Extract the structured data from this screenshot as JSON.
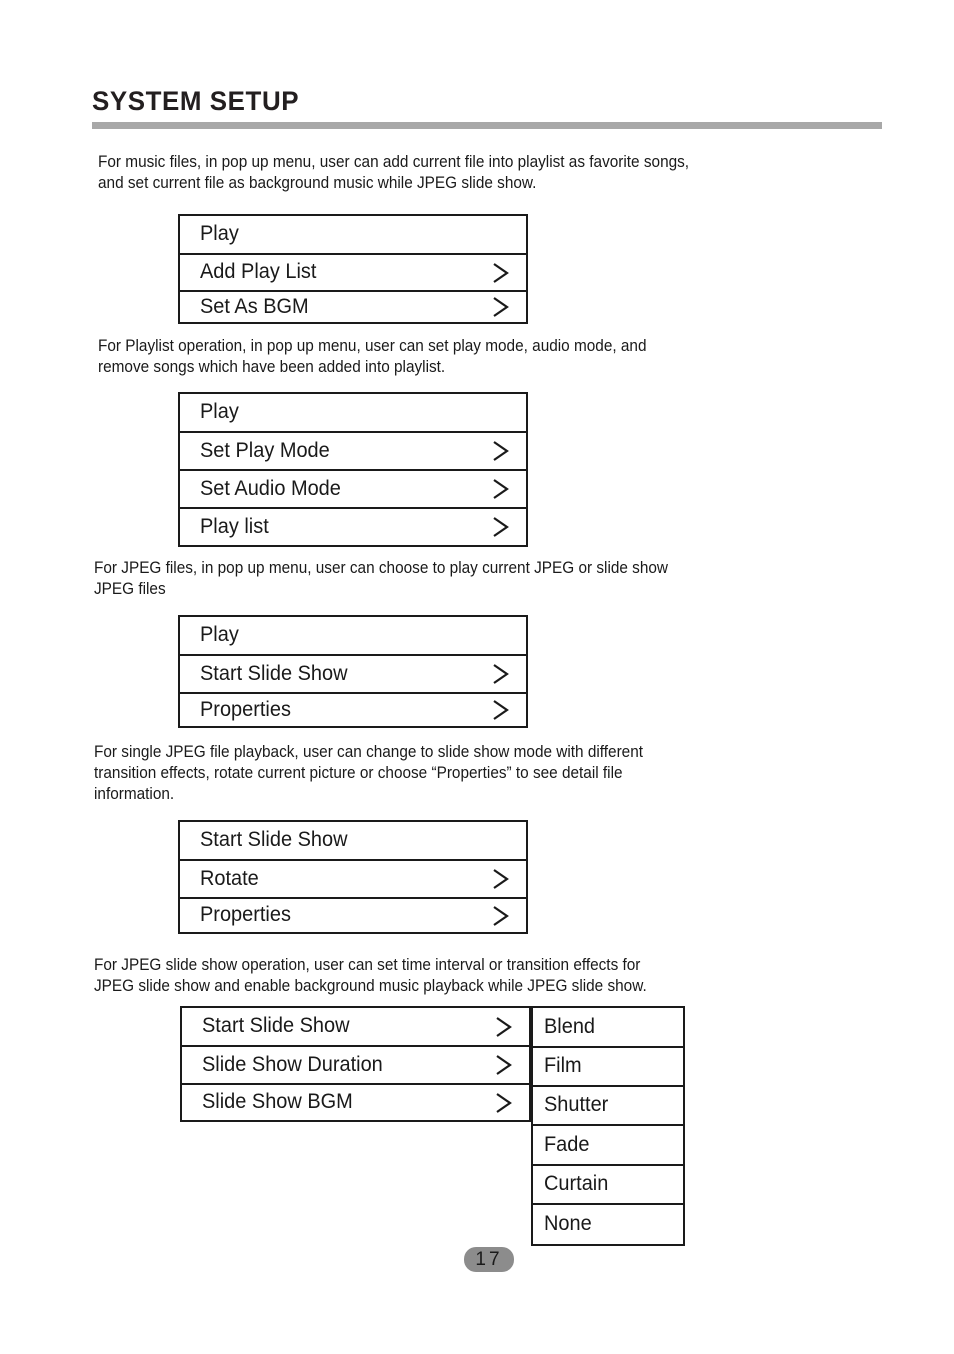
{
  "header": {
    "title": "SYSTEM SETUP"
  },
  "paragraphs": [
    {
      "id": "music-files",
      "text": "For music files, in pop up menu, user can add current file into playlist as favorite songs,\nand set current file as background music while JPEG slide show."
    },
    {
      "id": "playlist-operation",
      "text": "For Playlist operation, in pop up menu, user can set play mode, audio mode, and\nremove songs which have been added into playlist."
    },
    {
      "id": "jpeg-files",
      "text": "For JPEG files, in pop up menu, user can choose to play current JPEG or slide show\nJPEG files"
    },
    {
      "id": "single-jpeg-playback",
      "text": "For single JPEG file playback, user can change to slide show mode with different\ntransition effects, rotate current picture or choose “Properties” to see detail file\n information."
    },
    {
      "id": "jpeg-slide-show-operation",
      "text": "For JPEG slide show operation, user can set time interval or transition effects for\nJPEG slide show and enable background music playback while JPEG slide show."
    }
  ],
  "menus": [
    {
      "id": "music-popup-menu",
      "items": [
        {
          "label": "Play",
          "arrow": false
        },
        {
          "label": "Add Play List",
          "arrow": true
        },
        {
          "label": "Set As BGM",
          "arrow": true
        }
      ]
    },
    {
      "id": "playlist-popup-menu",
      "items": [
        {
          "label": "Play",
          "arrow": false
        },
        {
          "label": "Set Play Mode",
          "arrow": true
        },
        {
          "label": "Set Audio Mode",
          "arrow": true
        },
        {
          "label": "Play list",
          "arrow": true
        }
      ]
    },
    {
      "id": "jpeg-popup-menu",
      "items": [
        {
          "label": "Play",
          "arrow": false
        },
        {
          "label": "Start Slide Show",
          "arrow": true
        },
        {
          "label": "Properties",
          "arrow": true
        }
      ]
    },
    {
      "id": "single-jpeg-popup-menu",
      "items": [
        {
          "label": "Start Slide Show",
          "arrow": false
        },
        {
          "label": "Rotate",
          "arrow": true
        },
        {
          "label": "Properties",
          "arrow": true
        }
      ]
    },
    {
      "id": "slide-show-popup-menu",
      "items": [
        {
          "label": "Start Slide Show",
          "arrow": true
        },
        {
          "label": "Slide Show Duration",
          "arrow": true
        },
        {
          "label": "Slide Show BGM",
          "arrow": true
        }
      ]
    }
  ],
  "transition_submenu": {
    "id": "transition-effects-submenu",
    "items": [
      {
        "label": "Blend"
      },
      {
        "label": "Film"
      },
      {
        "label": "Shutter"
      },
      {
        "label": "Fade"
      },
      {
        "label": "Curtain"
      },
      {
        "label": "None"
      }
    ]
  },
  "footer": {
    "page_number": "17"
  },
  "colors": {
    "ink": "#1a1a1a",
    "rule": "#a8a8a8",
    "page_badge": "#8c8c8c",
    "background": "#ffffff"
  }
}
